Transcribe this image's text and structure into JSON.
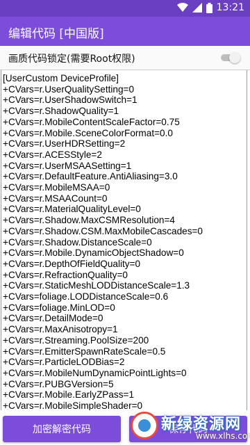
{
  "status_bar": {
    "time": "13:21",
    "icons": [
      "wifi-icon",
      "cell-signal-icon",
      "battery-icon"
    ]
  },
  "app_bar": {
    "title": "编辑代码 [中国版]"
  },
  "lock_toggle": {
    "label": "画质代码锁定(需要Root权限)",
    "on": false
  },
  "editor": {
    "lines": [
      "[UserCustom DeviceProfile]",
      "+CVars=r.UserQualitySetting=0",
      "+CVars=r.UserShadowSwitch=1",
      "+CVars=r.ShadowQuality=1",
      "+CVars=r.MobileContentScaleFactor=0.75",
      "+CVars=r.Mobile.SceneColorFormat=0.0",
      "+CVars=r.UserHDRSetting=2",
      "+CVars=r.ACESStyle=2",
      "+CVars=r.UserMSAASetting=1",
      "+CVars=r.DefaultFeature.AntiAliasing=3.0",
      "+CVars=r.MobileMSAA=0",
      "+CVars=r.MSAACount=0",
      "+CVars=r.MaterialQualityLevel=0",
      "+CVars=r.Shadow.MaxCSMResolution=4",
      "+CVars=r.Shadow.CSM.MaxMobileCascades=0",
      "+CVars=r.Shadow.DistanceScale=0",
      "+CVars=r.Mobile.DynamicObjectShadow=0",
      "+CVars=r.DepthOfFieldQuality=0",
      "+CVars=r.RefractionQuality=0",
      "+CVars=r.StaticMeshLODDistanceScale=1.3",
      "+CVars=foliage.LODDistanceScale=0.6",
      "+CVars=foliage.MinLOD=0",
      "+CVars=r.DetailMode=0",
      "+CVars=r.MaxAnisotropy=1",
      "+CVars=r.Streaming.PoolSize=200",
      "+CVars=r.EmitterSpawnRateScale=0.5",
      "+CVars=r.ParticleLODBias=2",
      "+CVars=r.MobileNumDynamicPointLights=0",
      "+CVars=r.PUBGVersion=5",
      "+CVars=r.Mobile.EarlyZPass=1",
      "+CVars=r.MobileSimpleShader=0"
    ]
  },
  "buttons": {
    "encrypt_label": "加密解密代码",
    "save_label": "保存代码"
  },
  "watermark": {
    "text": "新绿资源网",
    "url": "www.xlhs.com"
  },
  "colors": {
    "status_bar": "#6a3fc1",
    "app_bar": "#7c4ddb",
    "button": "#7c4ddb"
  }
}
